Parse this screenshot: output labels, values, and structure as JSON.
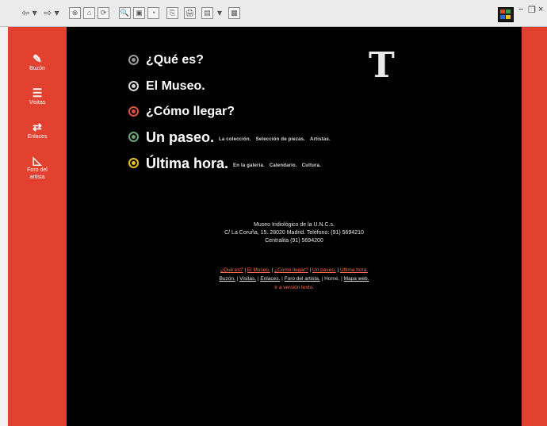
{
  "toolbar": {
    "back": "⇦ ▾",
    "forward": "⇨ ▾",
    "buttons": [
      "⊗",
      "⌂",
      "⟳",
      "🔍",
      "▣",
      "◔",
      "⎘",
      "🖨",
      "▤",
      "▾",
      "▦"
    ]
  },
  "window_controls": {
    "minimize": "−",
    "restore": "❐",
    "close": "×"
  },
  "sidebar": {
    "items": [
      {
        "icon": "✎",
        "label": "Buzón"
      },
      {
        "icon": "☰",
        "label": "Visitas"
      },
      {
        "icon": "⇄",
        "label": "Enlaces"
      },
      {
        "icon": "◺",
        "label": "Foro del artista"
      }
    ]
  },
  "logo": "T",
  "menu": [
    {
      "title": "¿Qué es?",
      "color": "#9a9a9a",
      "subs": []
    },
    {
      "title": "El Museo.",
      "color": "#d9d9d9",
      "subs": []
    },
    {
      "title": "¿Cómo llegar?",
      "color": "#e0503c",
      "subs": []
    },
    {
      "title": "Un paseo.",
      "color": "#6aa87a",
      "subs": [
        "La colección.",
        "Selección de piezas.",
        "Artistas."
      ]
    },
    {
      "title": "Última hora.",
      "color": "#e8c020",
      "subs": [
        "En la galería.",
        "Calendario.",
        "Cultura."
      ]
    }
  ],
  "address": {
    "line1": "Museo Iridiológico de la U.N.C.s.",
    "line2": "C/ La Coruña, 15. 28020 Madrid. Teléfono: (91) 5694210",
    "line3": "Centralita (91) 5694200"
  },
  "footer": {
    "row1": [
      "¿Qué es?",
      "El Museo.",
      "¿Cómo llegar?",
      "Un paseo.",
      "Última hora."
    ],
    "row2": [
      "Buzón.",
      "Visitas.",
      "Enlaces.",
      "Foro del artista.",
      "Home.",
      "Mapa web."
    ],
    "row3": "Ir a versión texto."
  }
}
